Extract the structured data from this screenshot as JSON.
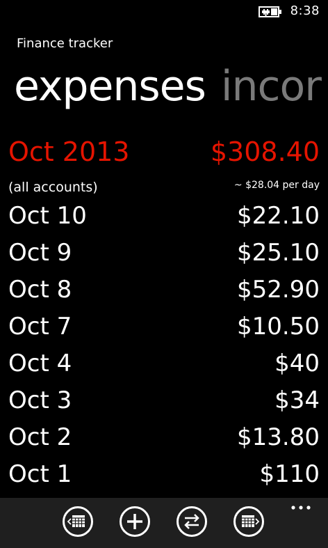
{
  "status": {
    "time": "8:38",
    "battery_icon": "battery-charging-icon"
  },
  "app": {
    "title": "Finance tracker"
  },
  "pivot": {
    "active": "expenses",
    "next": "incor"
  },
  "summary": {
    "month": "Oct 2013",
    "total": "$308.40",
    "subtitle": "(all accounts)",
    "rate": "~ $28.04 per day",
    "accent": "#e51400"
  },
  "rows": [
    {
      "date": "Oct 10",
      "amount": "$22.10"
    },
    {
      "date": "Oct 9",
      "amount": "$25.10"
    },
    {
      "date": "Oct 8",
      "amount": "$52.90"
    },
    {
      "date": "Oct 7",
      "amount": "$10.50"
    },
    {
      "date": "Oct 4",
      "amount": "$40"
    },
    {
      "date": "Oct 3",
      "amount": "$34"
    },
    {
      "date": "Oct 2",
      "amount": "$13.80"
    },
    {
      "date": "Oct 1",
      "amount": "$110"
    }
  ],
  "appbar": {
    "buttons": [
      {
        "name": "previous-month-button",
        "icon": "calendar-previous-icon"
      },
      {
        "name": "add-button",
        "icon": "plus-icon"
      },
      {
        "name": "transfer-button",
        "icon": "swap-arrows-icon"
      },
      {
        "name": "next-month-button",
        "icon": "calendar-next-icon"
      }
    ],
    "more_icon": "ellipsis-icon"
  }
}
